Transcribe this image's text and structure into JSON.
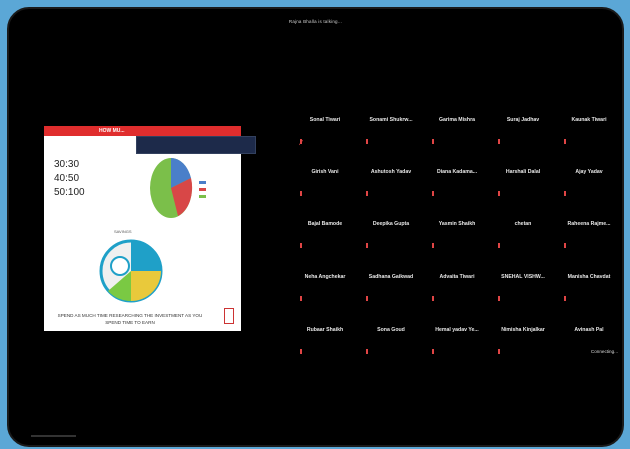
{
  "banner": "Rajna Bhalla is talking...",
  "slide": {
    "header": "HOW MU...",
    "ratios": [
      "30:30",
      "40:50",
      "50:100"
    ],
    "saving_label": "SAVINGS",
    "quote": "SPEND AS MUCH TIME RESEARCHING THE INVESTMENT AS YOU SPEND TIME TO EARN",
    "pie_colors": [
      "#4a7fc9",
      "#d84747",
      "#7bbf4a"
    ],
    "pie2_colors": [
      "#1fa0c8",
      "#e9c93b",
      "#7ac943",
      "#f0f0f0"
    ]
  },
  "participants": [
    [
      "Sonal Tiwari",
      "Sonami Shukrw...",
      "Garima Mishra",
      "Suraj Jadhav",
      "Kaunak Tiwari"
    ],
    [
      "Girish Vani",
      "Ashutosh Yadav",
      "Diana Kadama...",
      "Harshali Dalal",
      "Ajay Yadav"
    ],
    [
      "Bajal Bamode",
      "Deepika Gupta",
      "Yasmin Shaikh",
      "chetan",
      "Raheena Rajme..."
    ],
    [
      "Neha Angchekar",
      "Sadhana Gaikwad",
      "Advaita Tiwari",
      "SNEHAL VISHW...",
      "Manisha Chavdat"
    ],
    [
      "Rubaar Shaikh",
      "Sona Goud",
      "Hemal yadav Ye...",
      "Nimisha Kinjalkar",
      "Avinash Pal"
    ]
  ],
  "connecting_text": "Connecting...",
  "colors": {
    "mic_muted": "#e04545",
    "background": "#000000",
    "frame": "#5ba7d6"
  }
}
